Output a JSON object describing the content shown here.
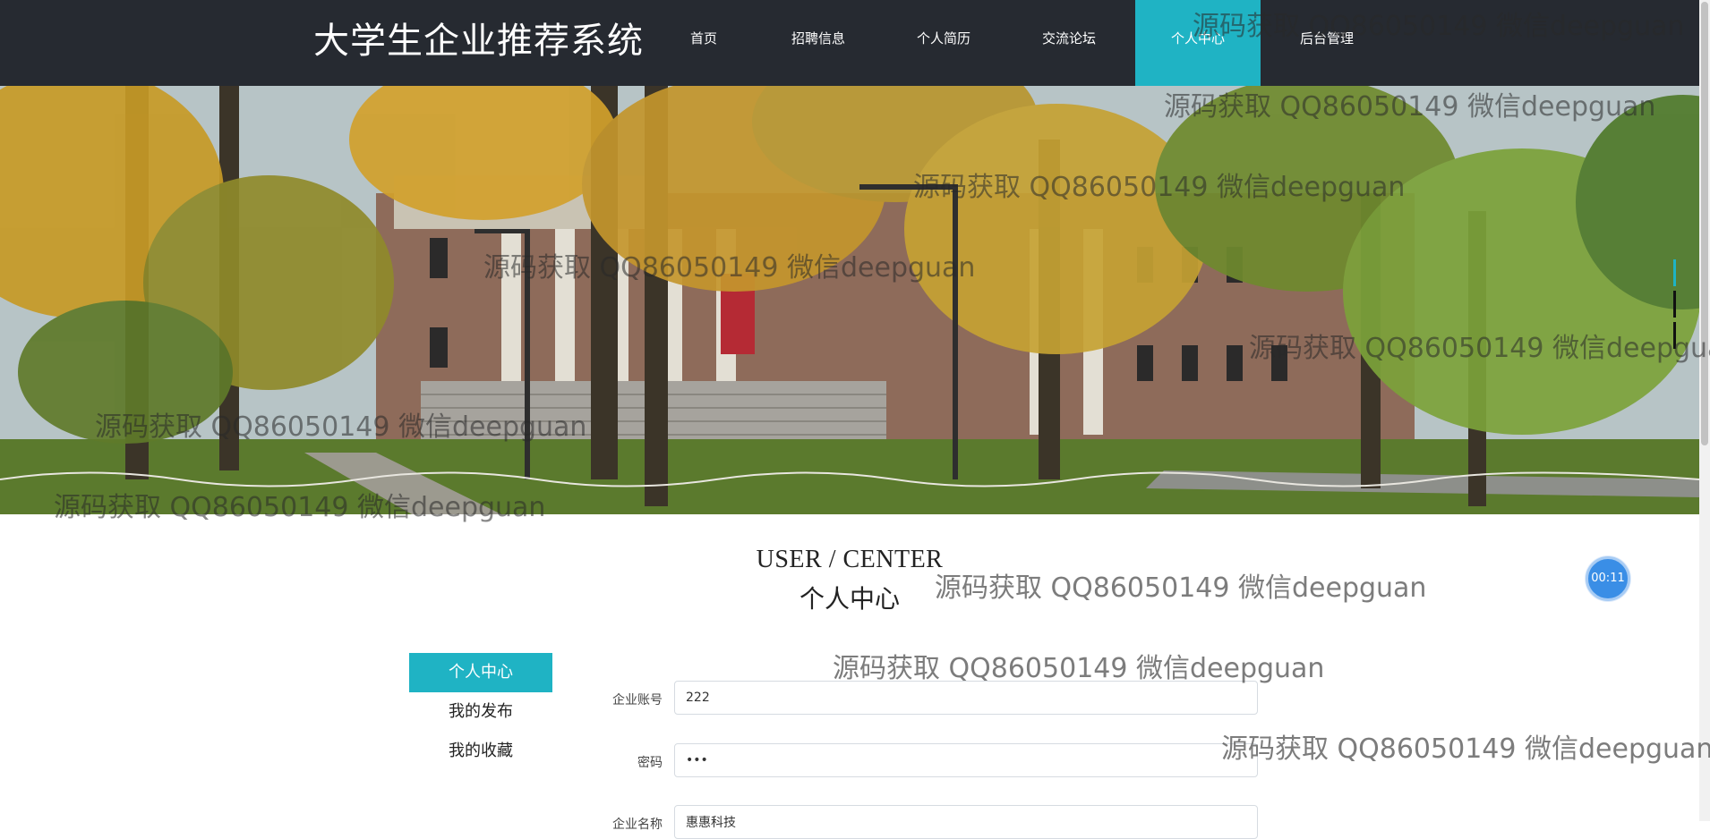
{
  "site_title": "大学生企业推荐系统",
  "nav": {
    "items": [
      {
        "label": "首页"
      },
      {
        "label": "招聘信息"
      },
      {
        "label": "个人简历"
      },
      {
        "label": "交流论坛"
      },
      {
        "label": "个人中心"
      },
      {
        "label": "后台管理"
      }
    ],
    "active_index": 4
  },
  "colors": {
    "topbar": "#262a31",
    "accent": "#1fb3c4",
    "timer": "#3a8ee6"
  },
  "heading": {
    "en": "USER / CENTER",
    "cn": "个人中心"
  },
  "timer": {
    "text": "00:11"
  },
  "side_menu": {
    "items": [
      {
        "label": "个人中心"
      },
      {
        "label": "我的发布"
      },
      {
        "label": "我的收藏"
      }
    ],
    "active_index": 0
  },
  "form": {
    "account": {
      "label": "企业账号",
      "value": "222"
    },
    "password": {
      "label": "密码",
      "value": "•••"
    },
    "company_name": {
      "label": "企业名称",
      "value": "惠惠科技"
    }
  },
  "watermark": {
    "text": "源码获取 QQ86050149 微信deepguan"
  }
}
